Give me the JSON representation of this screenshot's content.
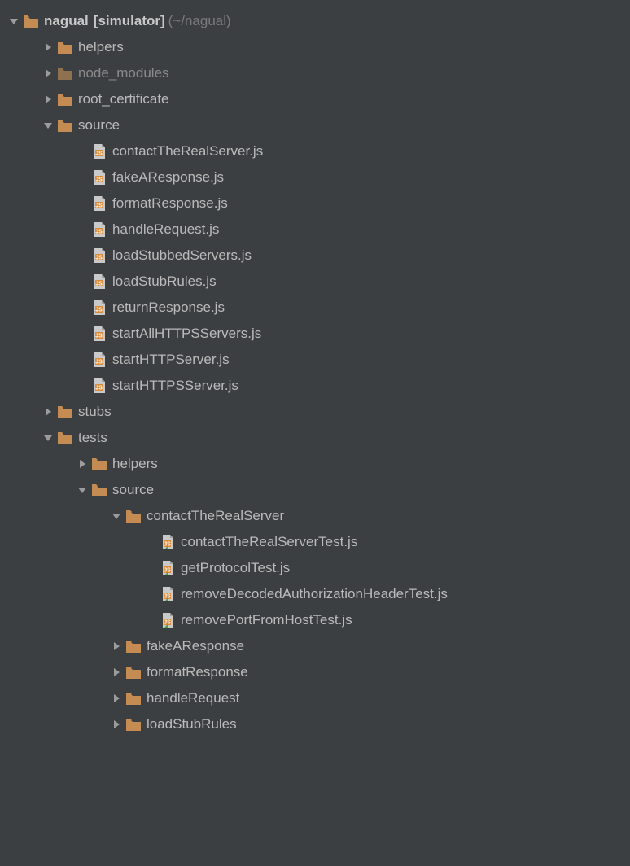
{
  "root": {
    "name": "nagual",
    "bracket": "[simulator]",
    "path": "(~/nagual)"
  },
  "folders": {
    "helpers": "helpers",
    "node_modules": "node_modules",
    "root_certificate": "root_certificate",
    "source": "source",
    "stubs": "stubs",
    "tests": "tests",
    "tests_helpers": "helpers",
    "tests_source": "source",
    "contactTheRealServer": "contactTheRealServer",
    "fakeAResponse": "fakeAResponse",
    "formatResponse": "formatResponse",
    "handleRequest": "handleRequest",
    "loadStubRules": "loadStubRules"
  },
  "source_files": {
    "f0": "contactTheRealServer.js",
    "f1": "fakeAResponse.js",
    "f2": "formatResponse.js",
    "f3": "handleRequest.js",
    "f4": "loadStubbedServers.js",
    "f5": "loadStubRules.js",
    "f6": "returnResponse.js",
    "f7": "startAllHTTPSServers.js",
    "f8": "startHTTPServer.js",
    "f9": "startHTTPSServer.js"
  },
  "test_files": {
    "t0": "contactTheRealServerTest.js",
    "t1": "getProtocolTest.js",
    "t2": "removeDecodedAuthorizationHeaderTest.js",
    "t3": "removePortFromHostTest.js"
  }
}
